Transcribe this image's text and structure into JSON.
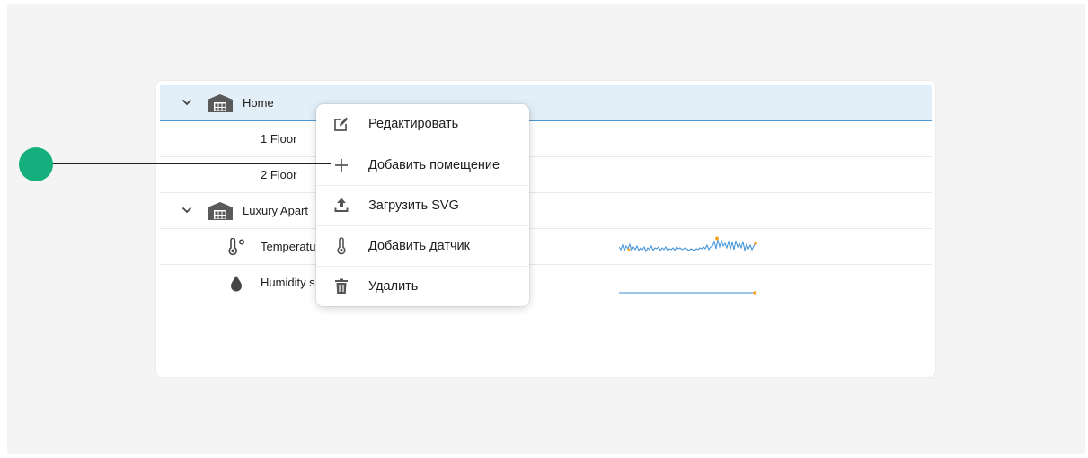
{
  "tree": {
    "rows": [
      {
        "label": "Home"
      },
      {
        "label": "1 Floor"
      },
      {
        "label": "2 Floor"
      },
      {
        "label": "Luxury Apart"
      },
      {
        "label": "Temperatu"
      },
      {
        "label": "Humidity s"
      }
    ]
  },
  "context_menu": {
    "items": [
      {
        "label": "Редактировать",
        "icon": "edit-icon"
      },
      {
        "label": "Добавить помещение",
        "icon": "plus-icon"
      },
      {
        "label": "Загрузить SVG",
        "icon": "upload-icon"
      },
      {
        "label": "Добавить датчик",
        "icon": "thermometer-icon"
      },
      {
        "label": "Удалить",
        "icon": "trash-icon"
      }
    ]
  },
  "colors": {
    "accent": "#4a9ad6",
    "selected_row": "#e2eef8",
    "callout": "#13b07d",
    "spark_line": "#3a8fd9",
    "spark_marker": "#f5a623",
    "icon_gray": "#5a5a5a"
  }
}
